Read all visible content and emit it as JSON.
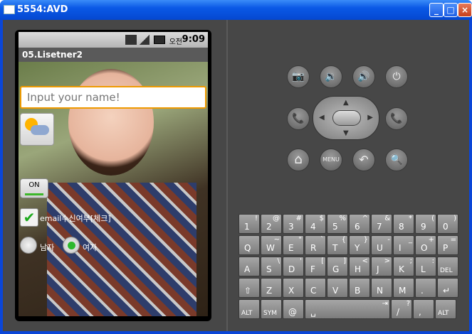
{
  "window": {
    "title": "5554:AVD",
    "minimize": "_",
    "maximize": "□",
    "close": "×"
  },
  "status": {
    "ampm": "오전",
    "time": "9:09"
  },
  "app": {
    "title": "05.Lisetner2"
  },
  "form": {
    "name_placeholder": "Input your name!",
    "toggle_label": "ON",
    "checkbox_mark": "✔",
    "checkbox_label": "email수신여부[체크]",
    "radio_male": "남자",
    "radio_female": "여자"
  },
  "controls": {
    "camera": "📷",
    "vol_down": "🔉",
    "vol_up": "🔊",
    "power": "⏻",
    "call": "📞",
    "end_call": "📞",
    "home": "⌂",
    "menu": "MENU",
    "back": "↶",
    "search": "🔍"
  },
  "keyboard": {
    "row1": [
      [
        "1",
        "!"
      ],
      [
        "2",
        "@"
      ],
      [
        "3",
        "#"
      ],
      [
        "4",
        "$"
      ],
      [
        "5",
        "%"
      ],
      [
        "6",
        "^"
      ],
      [
        "7",
        "&"
      ],
      [
        "8",
        "*"
      ],
      [
        "9",
        "("
      ],
      [
        "0",
        ")"
      ]
    ],
    "row2": [
      [
        "Q",
        ""
      ],
      [
        "W",
        "~"
      ],
      [
        "E",
        "\""
      ],
      [
        "R",
        "`"
      ],
      [
        "T",
        "{"
      ],
      [
        "Y",
        "}"
      ],
      [
        "U",
        "-"
      ],
      [
        "I",
        "_"
      ],
      [
        "O",
        "+"
      ],
      [
        "P",
        "="
      ]
    ],
    "row3": [
      [
        "A",
        ""
      ],
      [
        "S",
        "\\"
      ],
      [
        "D",
        "'"
      ],
      [
        "F",
        "["
      ],
      [
        "G",
        "]"
      ],
      [
        "H",
        "<"
      ],
      [
        "J",
        ">"
      ],
      [
        "K",
        ";"
      ],
      [
        "L",
        ":"
      ],
      [
        "DEL",
        ""
      ]
    ],
    "row4": [
      [
        "⇧",
        ""
      ],
      [
        "Z",
        ""
      ],
      [
        "X",
        ""
      ],
      [
        "C",
        ""
      ],
      [
        "V",
        ""
      ],
      [
        "B",
        ""
      ],
      [
        "N",
        ""
      ],
      [
        "M",
        ""
      ],
      [
        ".",
        ""
      ],
      [
        "↵",
        ""
      ]
    ],
    "row5": [
      [
        "ALT",
        ""
      ],
      [
        "SYM",
        ""
      ],
      [
        "@",
        ""
      ],
      [
        "␣",
        "⇥"
      ],
      [
        "/",
        "?"
      ],
      [
        ",",
        ""
      ],
      [
        "ALT",
        ""
      ]
    ]
  }
}
